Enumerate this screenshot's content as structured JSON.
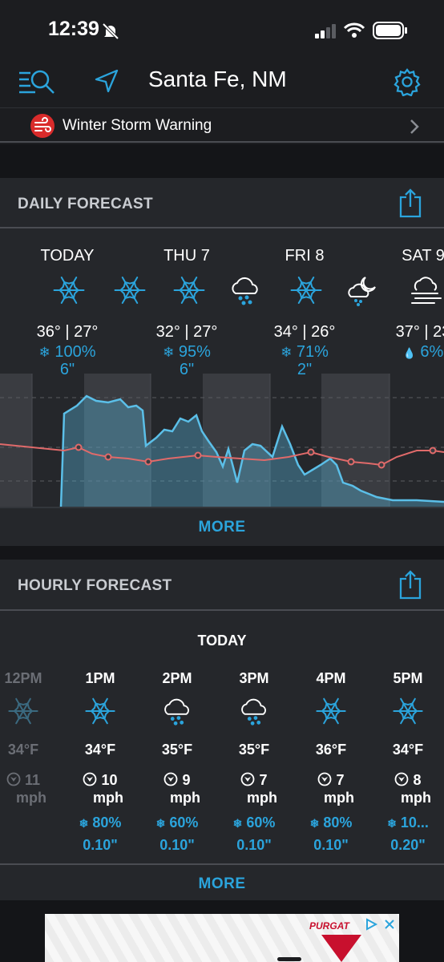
{
  "status_bar": {
    "time": "12:39"
  },
  "header": {
    "location": "Santa Fe, NM"
  },
  "alert": {
    "label": "Winter Storm Warning"
  },
  "daily": {
    "title": "DAILY FORECAST",
    "more_label": "MORE",
    "days": [
      {
        "name": "TODAY",
        "temps": "36° | 27°",
        "precip": "100%",
        "accum": "6\"",
        "icon_day": "snowflake-icon",
        "icon_night": "snowflake-icon"
      },
      {
        "name": "THU 7",
        "temps": "32° | 27°",
        "precip": "95%",
        "accum": "6\"",
        "icon_day": "snowflake-icon",
        "icon_night": "cloud-snow-icon"
      },
      {
        "name": "FRI 8",
        "temps": "34° | 26°",
        "precip": "71%",
        "accum": "2\"",
        "icon_day": "snowflake-icon",
        "icon_night": "moon-cloud-snow-icon"
      },
      {
        "name": "SAT 9",
        "temps": "37° | 23",
        "precip": "6%",
        "accum": "",
        "icon_day": "fog-icon",
        "icon_night": ""
      }
    ]
  },
  "hourly": {
    "title": "HOURLY FORECAST",
    "day_label": "TODAY",
    "more_label": "MORE",
    "hours": [
      {
        "time": "12PM",
        "temp": "34°F",
        "wind_speed": "11",
        "wind_unit": "mph",
        "precip": "",
        "amount": "",
        "icon": "snowflake-icon"
      },
      {
        "time": "1PM",
        "temp": "34°F",
        "wind_speed": "10",
        "wind_unit": "mph",
        "precip": "80%",
        "amount": "0.10\"",
        "icon": "snowflake-icon"
      },
      {
        "time": "2PM",
        "temp": "35°F",
        "wind_speed": "9",
        "wind_unit": "mph",
        "precip": "60%",
        "amount": "0.10\"",
        "icon": "cloud-snow-icon"
      },
      {
        "time": "3PM",
        "temp": "35°F",
        "wind_speed": "7",
        "wind_unit": "mph",
        "precip": "60%",
        "amount": "0.10\"",
        "icon": "cloud-snow-icon"
      },
      {
        "time": "4PM",
        "temp": "36°F",
        "wind_speed": "7",
        "wind_unit": "mph",
        "precip": "80%",
        "amount": "0.10\"",
        "icon": "snowflake-icon"
      },
      {
        "time": "5PM",
        "temp": "34°F",
        "wind_speed": "8",
        "wind_unit": "mph",
        "precip": "10...",
        "amount": "0.20\"",
        "icon": "snowflake-icon"
      }
    ]
  },
  "ad": {
    "brand": "PURGAT"
  },
  "colors": {
    "accent": "#2ba4dc",
    "temp_line": "#e06a6a",
    "precip_line": "#5bbfe8",
    "alert": "#d92b2b"
  }
}
